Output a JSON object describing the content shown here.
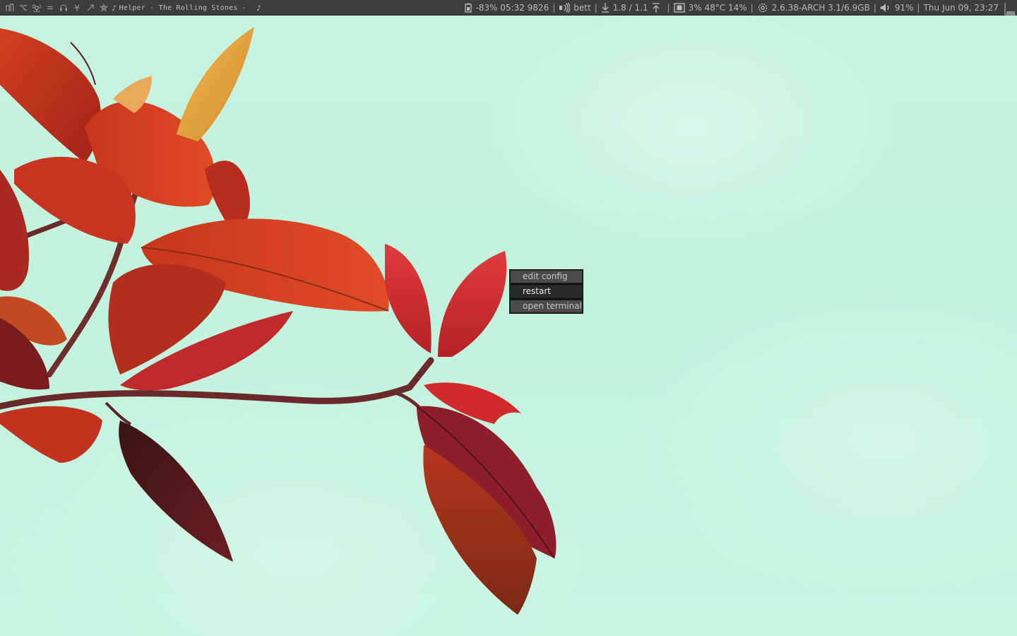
{
  "statusbar": {
    "tags": [
      {
        "icon": "tile-layout-icon"
      },
      {
        "icon": "branch-icon"
      },
      {
        "icon": "command-icon"
      },
      {
        "icon": "equals-icon"
      },
      {
        "icon": "headphones-icon"
      },
      {
        "icon": "asterisk-icon"
      },
      {
        "icon": "arrow-up-right-icon"
      },
      {
        "icon": "flower-icon"
      }
    ],
    "mpd": {
      "note": "♪",
      "title": "Helper - The Rolling Stones -",
      "note_end": "♪"
    },
    "battery": {
      "icon": "battery-icon",
      "text": "-83% 05:32 9826"
    },
    "wifi": {
      "icon": "wifi-icon",
      "text": "bett"
    },
    "network": {
      "down_icon": "download-icon",
      "text": "1.8 / 1.1",
      "up_icon": "upload-icon"
    },
    "cpu": {
      "icon": "cpu-icon",
      "text": "3% 48°C 14%"
    },
    "system": {
      "icon": "gear-icon",
      "text": "2.6.38-ARCH 3.1/6.9GB"
    },
    "volume": {
      "icon": "speaker-icon",
      "text": "91%"
    },
    "clock": {
      "text": "Thu Jun 09, 23:27"
    },
    "separator": "|",
    "layout_icon": "floating-layout-icon"
  },
  "menu": {
    "items": [
      {
        "label": "edit config",
        "state": "normal"
      },
      {
        "label": "restart",
        "state": "active"
      },
      {
        "label": "open terminal",
        "state": "normal"
      }
    ]
  },
  "colors": {
    "bar_bg": "#3d3d3d",
    "bar_fg": "#b8b8b8",
    "menu_normal_bg": "#4b4b4b",
    "menu_active_bg": "#2a2a2a",
    "sky": "#c5f3df"
  }
}
